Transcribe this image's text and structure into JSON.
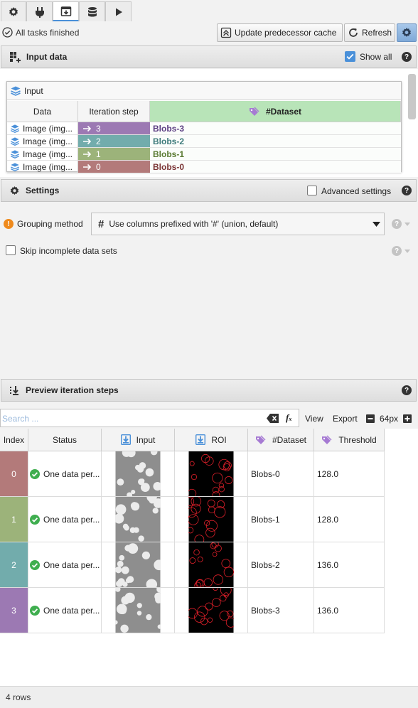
{
  "tabs": [
    {
      "icon": "gear-icon"
    },
    {
      "icon": "plug-icon"
    },
    {
      "icon": "iteration-step-icon",
      "active": true
    },
    {
      "icon": "database-icon"
    },
    {
      "icon": "play-icon"
    }
  ],
  "status": {
    "text": "All tasks finished",
    "update_cache_label": "Update predecessor cache",
    "refresh_label": "Refresh"
  },
  "input_data": {
    "title": "Input data",
    "show_all_label": "Show all",
    "show_all_checked": true,
    "input_title": "Input",
    "columns": [
      "Data",
      "Iteration step",
      "#Dataset"
    ],
    "rows": [
      {
        "data": "Image (img...",
        "step": "3",
        "dataset": "Blobs-3",
        "color": "#9c79b3",
        "dscolor": "#5b3d82"
      },
      {
        "data": "Image (img...",
        "step": "2",
        "dataset": "Blobs-2",
        "color": "#72acac",
        "dscolor": "#3c7a7a"
      },
      {
        "data": "Image (img...",
        "step": "1",
        "dataset": "Blobs-1",
        "color": "#9cb37a",
        "dscolor": "#5a7a32"
      },
      {
        "data": "Image (img...",
        "step": "0",
        "dataset": "Blobs-0",
        "color": "#b37a7a",
        "dscolor": "#7a3434"
      }
    ]
  },
  "settings": {
    "title": "Settings",
    "advanced_label": "Advanced settings",
    "grouping_label": "Grouping method",
    "grouping_value": "Use columns prefixed with '#' (union, default)",
    "skip_label": "Skip incomplete data sets"
  },
  "preview": {
    "title": "Preview iteration steps",
    "search_placeholder": "Search ...",
    "view_label": "View",
    "export_label": "Export",
    "zoom_label": "64px",
    "columns": [
      "Index",
      "Status",
      "Input",
      "ROI",
      "#Dataset",
      "Threshold"
    ],
    "rows": [
      {
        "index": "0",
        "status": "One data per...",
        "dataset": "Blobs-0",
        "threshold": "128.0",
        "color": "#b37a7a"
      },
      {
        "index": "1",
        "status": "One data per...",
        "dataset": "Blobs-1",
        "threshold": "128.0",
        "color": "#9cb37a"
      },
      {
        "index": "2",
        "status": "One data per...",
        "dataset": "Blobs-2",
        "threshold": "136.0",
        "color": "#72acac"
      },
      {
        "index": "3",
        "status": "One data per...",
        "dataset": "Blobs-3",
        "threshold": "136.0",
        "color": "#9c79b3"
      }
    ],
    "row_count": "4 rows"
  }
}
